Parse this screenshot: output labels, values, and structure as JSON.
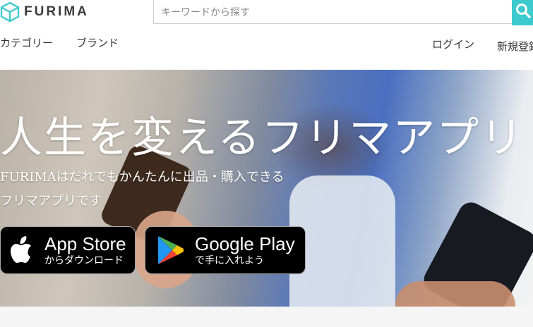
{
  "header": {
    "logo_text": "FURIMA",
    "search": {
      "placeholder": "キーワードから探す",
      "button_icon": "search-icon"
    },
    "nav": {
      "category": "カテゴリー",
      "brand": "ブランド",
      "login": "ログイン",
      "signup": "新規登録"
    }
  },
  "hero": {
    "title": "人生を変えるフリマアプリ",
    "subtitle_line1": "FURIMAはだれでもかんたんに出品・購入できる",
    "subtitle_line2": "フリマアプリです",
    "app_store": {
      "main": "App Store",
      "sub": "からダウンロード",
      "icon": "apple-icon"
    },
    "google_play": {
      "main": "Google Play",
      "sub": "で手に入れよう",
      "icon": "google-play-icon"
    }
  },
  "colors": {
    "accent": "#3ccace",
    "text": "#333333",
    "logo": "#3ccace"
  }
}
